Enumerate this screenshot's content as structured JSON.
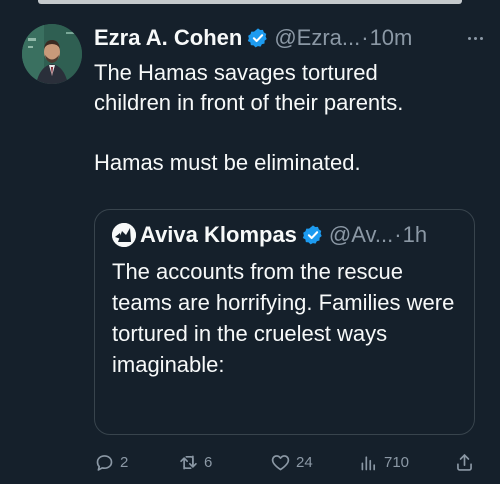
{
  "tweet": {
    "author_name": "Ezra A. Cohen",
    "handle": "@Ezra...",
    "separator": "·",
    "time": "10m",
    "text_line1": "The Hamas savages tortured",
    "text_line2": "children in front of their parents.",
    "text_line3": "Hamas must be eliminated."
  },
  "quote": {
    "author_name": "Aviva Klompas",
    "handle": "@Av...",
    "separator": "·",
    "time": "1h",
    "text": "The accounts from the rescue teams are horrifying. Families were tortured in the cruelest ways imaginable:"
  },
  "actions": {
    "replies": "2",
    "reposts": "6",
    "likes": "24",
    "views": "710"
  },
  "icons": {
    "reply": "reply-icon",
    "repost": "repost-icon",
    "like": "heart-icon",
    "views": "views-icon",
    "share": "share-icon",
    "verified": "verified-badge-icon",
    "more": "more-icon"
  },
  "colors": {
    "background": "#15202b",
    "verified_blue": "#1d9bf0",
    "text_primary": "#f7f9f9",
    "text_secondary": "#8b98a5",
    "border": "#38444d"
  }
}
